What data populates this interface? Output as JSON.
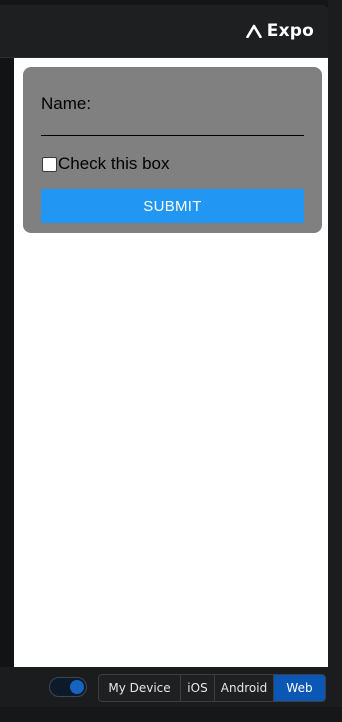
{
  "header": {
    "brand_label": "Expo",
    "brand_icon": "expo-caret-icon"
  },
  "form": {
    "name_label": "Name:",
    "name_value": "",
    "checkbox_label": "Check this box",
    "checkbox_checked": false,
    "submit_label": "SUBMIT",
    "card_color": "#808080",
    "button_color": "#2196f3"
  },
  "toolbar": {
    "toggle_on": true,
    "platforms": [
      {
        "label": "My Device",
        "active": false
      },
      {
        "label": "iOS",
        "active": false
      },
      {
        "label": "Android",
        "active": false
      },
      {
        "label": "Web",
        "active": true
      }
    ],
    "active_color": "#0b57b5"
  }
}
